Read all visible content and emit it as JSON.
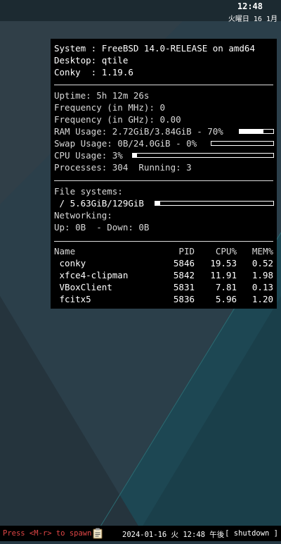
{
  "topbar": {
    "time": "12:48",
    "date": "火曜日 16 1月"
  },
  "conky": {
    "system": "System : FreeBSD 14.0-RELEASE on amd64",
    "desktop": "Desktop: qtile",
    "conky_version": "Conky  : 1.19.6",
    "uptime": "Uptime: 5h 12m 26s",
    "freq_mhz": "Frequency (in MHz): 0",
    "freq_ghz": "Frequency (in GHz): 0.00",
    "ram": {
      "text": "RAM Usage: 2.72GiB/3.84GiB - 70%",
      "percent": 70
    },
    "swap": {
      "text": "Swap Usage: 0B/24.0GiB - 0%",
      "percent": 0
    },
    "cpu": {
      "text": "CPU Usage: 3%",
      "percent": 3
    },
    "processes": "Processes: 304  Running: 3",
    "fs_label": "File systems:",
    "fs": {
      "text": " / 5.63GiB/129GiB",
      "percent": 4.4
    },
    "net_label": "Networking:",
    "net": "Up: 0B  - Down: 0B",
    "proc_headers": {
      "name": "Name",
      "pid": "PID",
      "cpu": "CPU%",
      "mem": "MEM%"
    },
    "procs": [
      {
        "name": " conky",
        "pid": "5846",
        "cpu": "19.53",
        "mem": "0.52"
      },
      {
        "name": " xfce4-clipman",
        "pid": "5842",
        "cpu": "11.91",
        "mem": "1.98"
      },
      {
        "name": " VBoxClient",
        "pid": "5831",
        "cpu": "7.81",
        "mem": "0.13"
      },
      {
        "name": " fcitx5",
        "pid": "5836",
        "cpu": "5.96",
        "mem": "1.20"
      }
    ]
  },
  "bottombar": {
    "prompt": "Press <M-r> to spawn",
    "tray_icon": "clipboard-icon",
    "datetime": "2024-01-16 火 12:48 午後",
    "shutdown": "[ shutdown ]"
  },
  "colors": {
    "background": "#263a44",
    "prompt": "#e04646",
    "panel": "#000000"
  }
}
